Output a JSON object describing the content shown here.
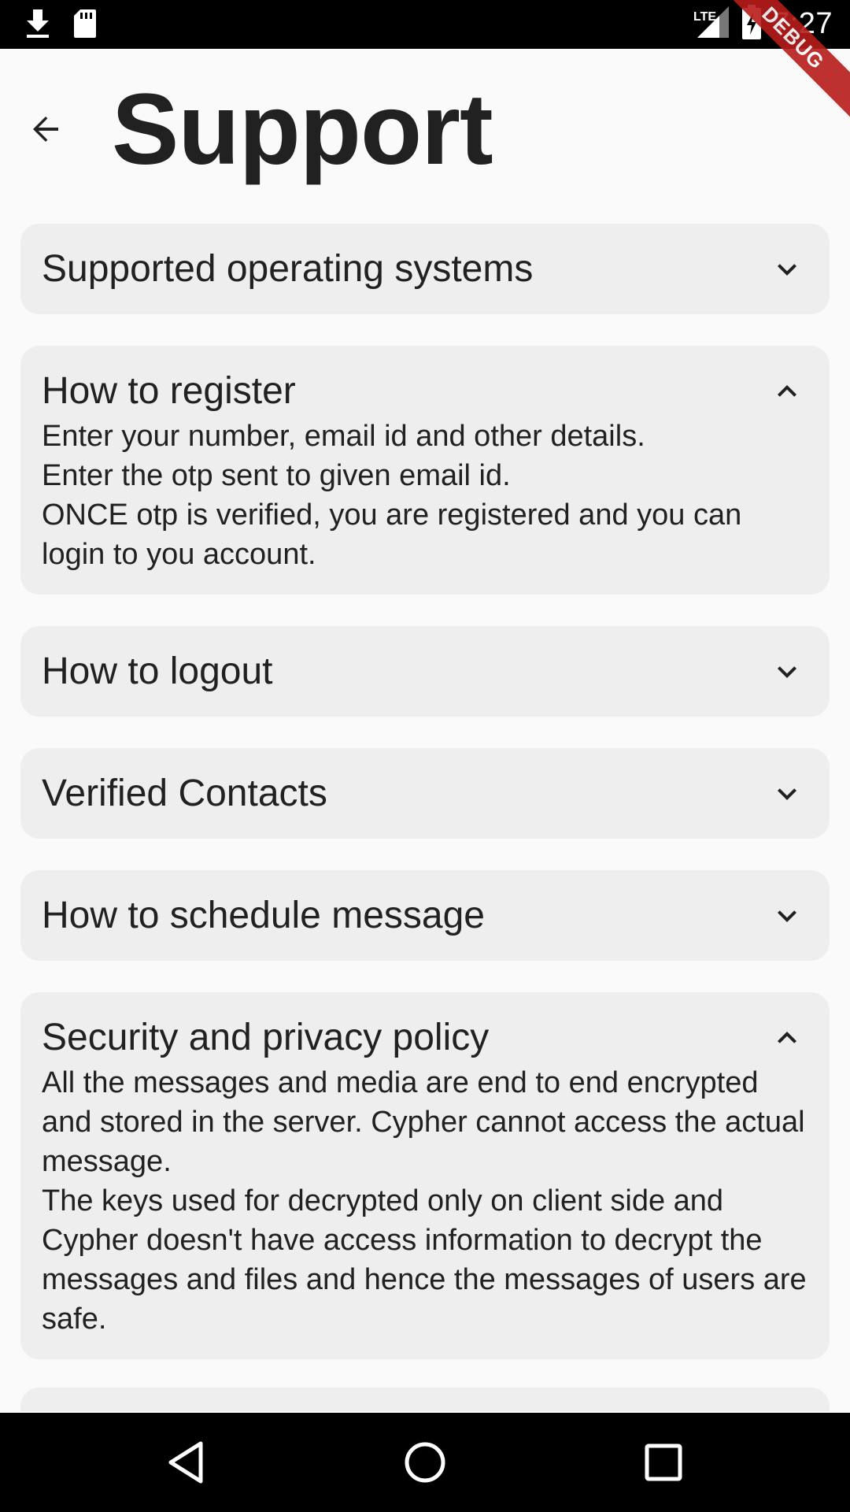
{
  "status_bar": {
    "time": "7:27",
    "network": "LTE",
    "icons": [
      "download-icon",
      "sd-card-icon",
      "signal-icon",
      "battery-charging-icon"
    ]
  },
  "debug_banner": "DEBUG",
  "header": {
    "title": "Support",
    "back_icon": "arrow-back-icon"
  },
  "faq": [
    {
      "title": "Supported operating systems",
      "expanded": false,
      "body": ""
    },
    {
      "title": "How to register",
      "expanded": true,
      "body": "Enter your number, email id and other details.\nEnter the otp sent to given email id.\nONCE otp is verified, you are registered and you can login to you account."
    },
    {
      "title": "How to logout",
      "expanded": false,
      "body": ""
    },
    {
      "title": "Verified Contacts",
      "expanded": false,
      "body": ""
    },
    {
      "title": "How to schedule message",
      "expanded": false,
      "body": ""
    },
    {
      "title": "Security and privacy policy",
      "expanded": true,
      "body": "All the messages and media are end to end encrypted and stored in the server. Cypher cannot access the actual message.\nThe keys used for decrypted only on client side and Cypher doesn't have access information to decrypt the messages and files and hence the messages of users are safe."
    }
  ],
  "nav": [
    "back-triangle-icon",
    "home-circle-icon",
    "recents-square-icon"
  ],
  "colors": {
    "card_bg": "#eeeeee",
    "page_bg": "#fafafa",
    "debug": "#b71c1c"
  }
}
